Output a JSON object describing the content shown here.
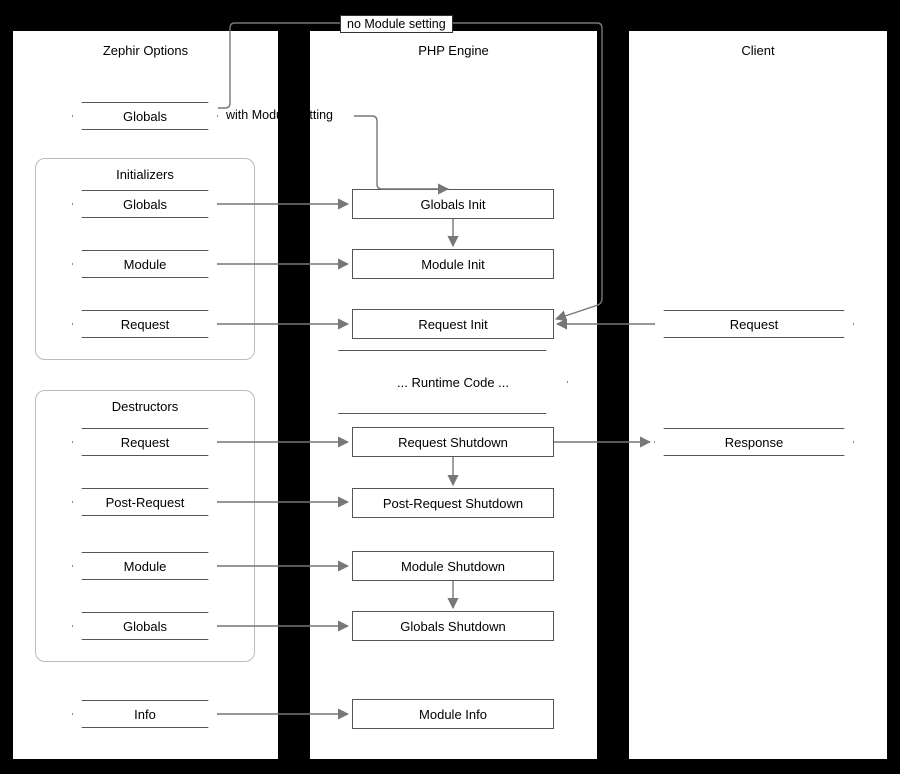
{
  "columns": {
    "zephir": "Zephir Options",
    "php": "PHP Engine",
    "client": "Client"
  },
  "groups": {
    "initializers": "Initializers",
    "destructors": "Destructors"
  },
  "zephir": {
    "globals": "Globals",
    "init_globals": "Globals",
    "init_module": "Module",
    "init_request": "Request",
    "dest_request": "Request",
    "dest_postrequest": "Post-Request",
    "dest_module": "Module",
    "dest_globals": "Globals",
    "info": "Info"
  },
  "php": {
    "globals_init": "Globals Init",
    "module_init": "Module Init",
    "request_init": "Request Init",
    "runtime": "... Runtime Code ...",
    "request_shutdown": "Request Shutdown",
    "post_request_shutdown": "Post-Request Shutdown",
    "module_shutdown": "Module Shutdown",
    "globals_shutdown": "Globals Shutdown",
    "module_info": "Module Info"
  },
  "client": {
    "request": "Request",
    "response": "Response"
  },
  "labels": {
    "no_module": "no Module setting",
    "with_module": "with Module setting"
  }
}
